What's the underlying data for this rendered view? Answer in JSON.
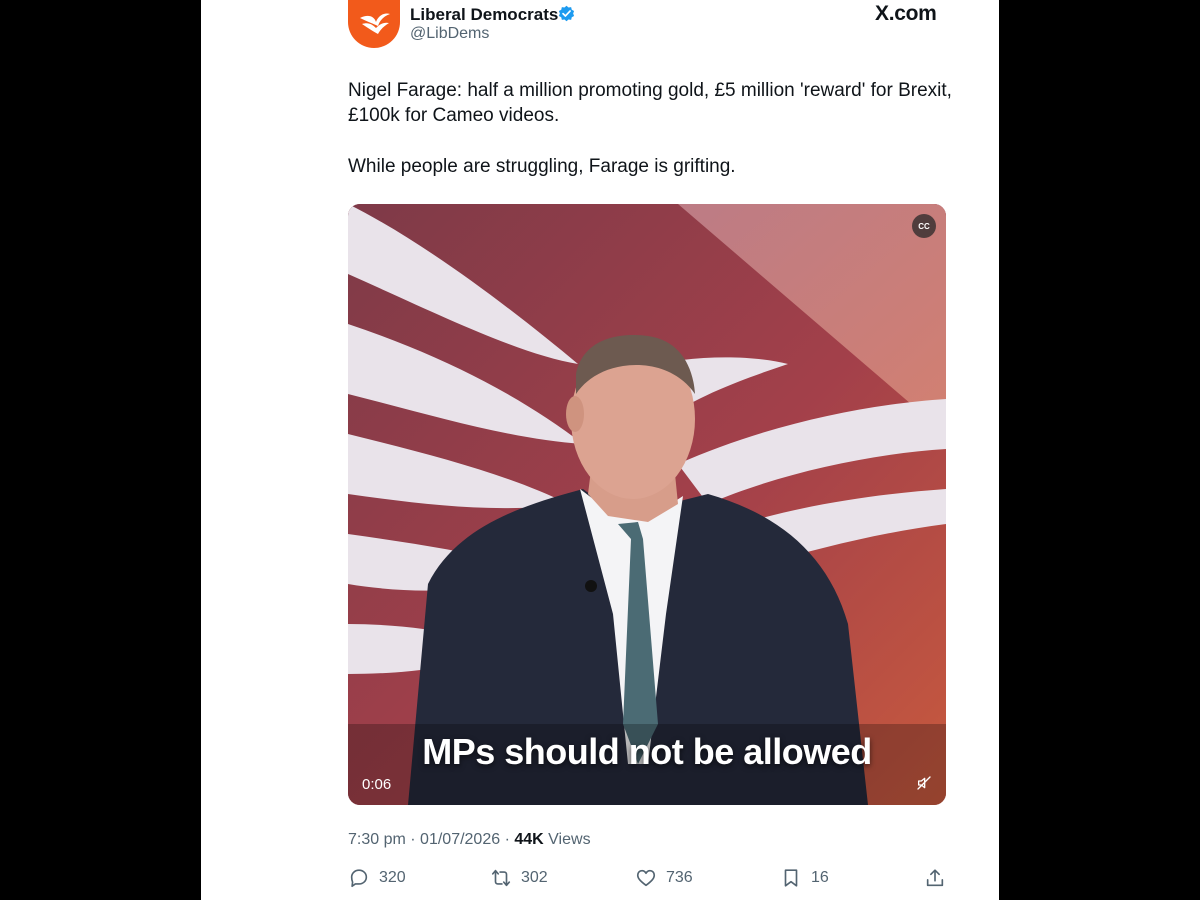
{
  "author": {
    "name": "Liberal Democrats",
    "handle": "@LibDems",
    "verified": true,
    "avatar_color": "#f25a1b"
  },
  "site_label": "X.com",
  "tweet": {
    "paragraphs": [
      "Nigel Farage: half a million promoting gold, £5 million 'reward' for Brexit, £100k for Cameo videos.",
      "While people are struggling, Farage is grifting."
    ]
  },
  "video": {
    "caption": "MPs should not be allowed",
    "timecode": "0:06",
    "cc_label": "CC",
    "muted": true
  },
  "meta": {
    "time": "7:30 pm",
    "date": "01/07/2026",
    "separator": "·",
    "views_count": "44K",
    "views_label": "Views"
  },
  "actions": {
    "replies": "320",
    "reposts": "302",
    "likes": "736",
    "bookmarks": "16"
  },
  "colors": {
    "verified_blue": "#1d9bf0",
    "secondary_text": "#536471",
    "primary_text": "#0f1419"
  }
}
